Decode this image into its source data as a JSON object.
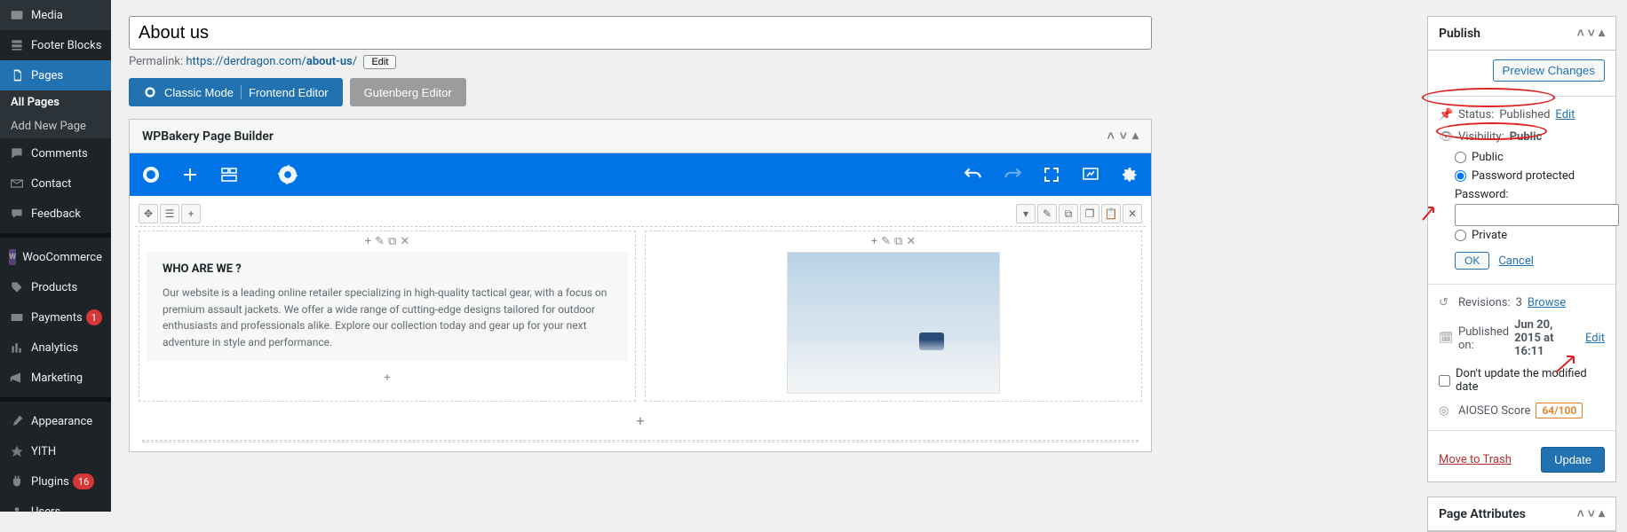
{
  "sidebar": {
    "items": [
      {
        "icon": "media-icon",
        "label": "Media"
      },
      {
        "icon": "footer-icon",
        "label": "Footer Blocks"
      },
      {
        "icon": "pages-icon",
        "label": "Pages",
        "active": true
      },
      {
        "icon": "comments-icon",
        "label": "Comments"
      },
      {
        "icon": "contact-icon",
        "label": "Contact"
      },
      {
        "icon": "feedback-icon",
        "label": "Feedback"
      },
      {
        "icon": "woo-icon",
        "label": "WooCommerce"
      },
      {
        "icon": "products-icon",
        "label": "Products"
      },
      {
        "icon": "payments-icon",
        "label": "Payments",
        "badge": "1"
      },
      {
        "icon": "analytics-icon",
        "label": "Analytics"
      },
      {
        "icon": "marketing-icon",
        "label": "Marketing"
      },
      {
        "icon": "appearance-icon",
        "label": "Appearance"
      },
      {
        "icon": "yith-icon",
        "label": "YITH"
      },
      {
        "icon": "plugins-icon",
        "label": "Plugins",
        "badge": "16"
      },
      {
        "icon": "users-icon",
        "label": "Users"
      }
    ],
    "submenu": {
      "all": "All Pages",
      "add": "Add New Page"
    }
  },
  "title": "About us",
  "permalink": {
    "label": "Permalink:",
    "base": "https://derdragon.com/",
    "slug": "about-us",
    "trail": "/",
    "edit": "Edit"
  },
  "modes": {
    "classic": "Classic Mode",
    "frontend": "Frontend Editor",
    "gutenberg": "Gutenberg Editor"
  },
  "wpb": {
    "title": "WPBakery Page Builder"
  },
  "content": {
    "heading": "WHO ARE WE ?",
    "body": "Our website is a leading online retailer specializing in high-quality tactical gear, with a focus on premium assault jackets. We offer a wide range of cutting-edge designs tailored for outdoor enthusiasts and professionals alike. Explore our collection today and gear up for your next adventure in style and performance."
  },
  "publish": {
    "title": "Publish",
    "preview": "Preview Changes",
    "status_label": "Status:",
    "status_value": "Published",
    "status_edit": "Edit",
    "visibility_label": "Visibility:",
    "visibility_value": "Public",
    "radio_public": "Public",
    "radio_password": "Password protected",
    "radio_private": "Private",
    "password_label": "Password:",
    "ok": "OK",
    "cancel": "Cancel",
    "revisions_label": "Revisions:",
    "revisions_count": "3",
    "browse": "Browse",
    "published_label": "Published on:",
    "published_value": "Jun 20, 2015 at 16:11",
    "published_edit": "Edit",
    "dont_update": "Don't update the modified date",
    "aioseo_label": "AIOSEO Score",
    "aioseo_value": "64/100",
    "trash": "Move to Trash",
    "update": "Update"
  },
  "page_attr": {
    "title": "Page Attributes"
  }
}
